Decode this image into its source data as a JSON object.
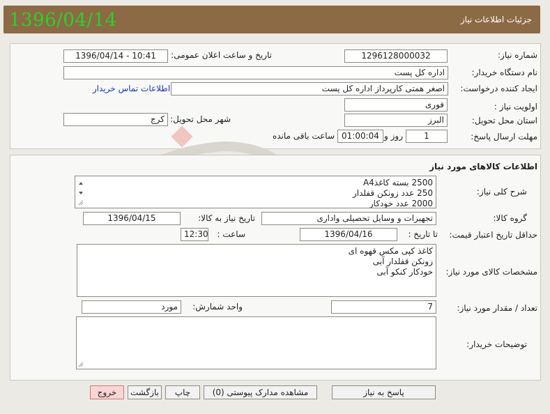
{
  "header": {
    "title": "جزئیات اطلاعات نیاز",
    "date": "1396/04/14"
  },
  "need_info": {
    "need_number_label": "شماره نیاز:",
    "need_number": "1296128000032",
    "announce_label": "تاریخ و ساعت اعلان عمومی:",
    "announce_value": "1396/04/14 - 10:41",
    "buyer_org_label": "نام دستگاه خریدار:",
    "buyer_org": "اداره کل پست",
    "creator_label": "ایجاد کننده درخواست:",
    "creator": "اصغر همتی کارپرداز اداره کل پست",
    "contact_link": "اطلاعات تماس خریدار",
    "priority_label": "اولویت نیاز :",
    "priority": "فوری",
    "province_label": "استان محل تحویل:",
    "province": "البرز",
    "city_label": "شهر محل تحویل:",
    "city": "کرج",
    "deadline_label": "مهلت ارسال پاسخ:",
    "deadline_days": "1",
    "deadline_days_unit": "روز و",
    "deadline_time": "01:00:04",
    "deadline_remaining": "ساعت باقی مانده"
  },
  "goods": {
    "section_title": "اطلاعات کالاهای مورد نیاز",
    "summary_label": "شرح کلی نیاز:",
    "summary_lines": [
      "2500 بسته کاغذA4",
      "250 عدد زونکن قفلدار",
      "2000 عدد خودکار"
    ],
    "group_label": "گروه کالا:",
    "group": "تجهیزات و وسایل تحصیلی واداری",
    "need_date_label": "تاریخ نیاز به کالا:",
    "need_date": "1396/04/15",
    "validity_label": "حداقل تاریخ اعتبار قیمت:",
    "until_label": "تا تاریخ :",
    "validity_date": "1396/04/16",
    "time_label": "ساعت :",
    "validity_time": "12:30",
    "specs_label": "مشخصات کالای مورد نیاز:",
    "specs_lines": [
      "کاغذ کپی مکس قهوه ای",
      "زونکن قفلدار آبی",
      "خودکار کنکو آبی"
    ],
    "quantity_label": "تعداد / مقدار مورد نیاز:",
    "quantity": "7",
    "unit_label": "واحد شمارش:",
    "unit": "مورد",
    "buyer_notes_label": "توضیحات خریدار:",
    "buyer_notes": ""
  },
  "buttons": {
    "reply": "پاسخ به نیاز",
    "attachments": "مشاهده مدارک پیوستی (0)",
    "print": "چاپ",
    "back": "بازگشت",
    "exit": "خروج"
  },
  "colors": {
    "header_bg": "#8c6a45",
    "date_green": "#2bd12b",
    "link_blue": "#1d37b3",
    "exit_bg": "#fad5d5"
  },
  "icons": [
    "scroll-up-icon",
    "scroll-down-icon",
    "resize-grip-icon"
  ]
}
